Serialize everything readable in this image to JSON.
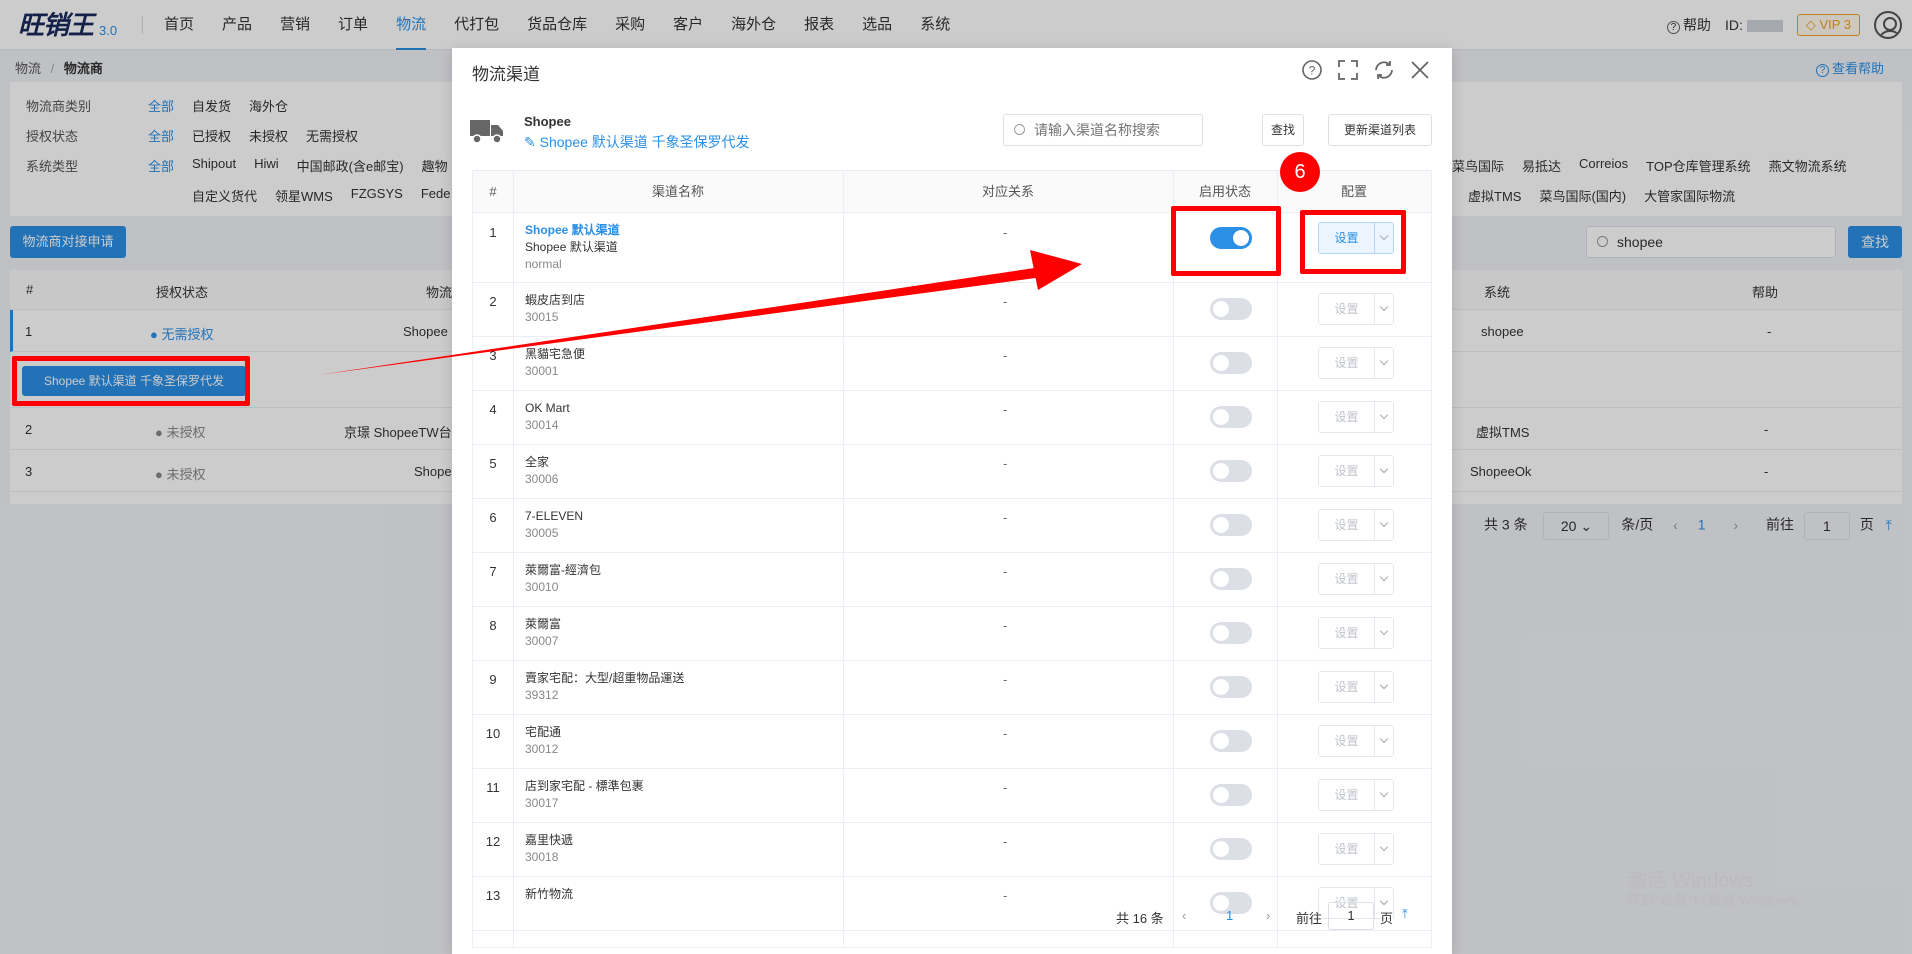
{
  "logo": {
    "text": "旺销王",
    "version": "3.0"
  },
  "nav": [
    "首页",
    "产品",
    "营销",
    "订单",
    "物流",
    "代打包",
    "货品仓库",
    "采购",
    "客户",
    "海外仓",
    "报表",
    "选品",
    "系统"
  ],
  "top_right": {
    "help": "帮助",
    "id_label": "ID:",
    "vip": "VIP 3"
  },
  "breadcrumb": {
    "parent": "物流",
    "current": "物流商"
  },
  "help_link": "查看帮助",
  "filters": {
    "carrier_type": {
      "label": "物流商类别",
      "options": [
        "全部",
        "自发货",
        "海外仓"
      ]
    },
    "auth_status": {
      "label": "授权状态",
      "options": [
        "全部",
        "已授权",
        "未授权",
        "无需授权"
      ]
    },
    "system_type": {
      "label": "系统类型",
      "options_left": [
        "全部",
        "Shipout",
        "Hiwi",
        "中国邮政(含e邮宝)",
        "趣物"
      ],
      "options_right": [
        "菜鸟国际",
        "易抵达",
        "Correios",
        "TOP仓库管理系统",
        "燕文物流系统"
      ],
      "row2_left": [
        "自定义货代",
        "领星WMS",
        "FZGSYS",
        "Fede"
      ],
      "row2_right": [
        "虚拟TMS",
        "菜鸟国际(国内)",
        "大管家国际物流"
      ]
    }
  },
  "apply_button": "物流商对接申请",
  "search": {
    "value": "shopee",
    "button": "查找"
  },
  "main_table": {
    "headers": [
      "#",
      "授权状态",
      "物流",
      "系统",
      "帮助"
    ],
    "rows": [
      {
        "num": "1",
        "status": "无需授权",
        "carrier": "Shopee",
        "system": "shopee",
        "help": "-"
      },
      {
        "num": "2",
        "status": "未授权",
        "carrier": "京璟 ShopeeTW台",
        "system": "虚拟TMS",
        "help": "-"
      },
      {
        "num": "3",
        "status": "未授权",
        "carrier": "Shope",
        "system": "ShopeeOk",
        "help": "-"
      }
    ],
    "expanded_channel": "Shopee 默认渠道 千象圣保罗代发"
  },
  "main_pager": {
    "total": "共 3 条",
    "page_size": "20",
    "per_page": "条/页",
    "page": "1",
    "goto": "前往",
    "goto_value": "1",
    "page_unit": "页"
  },
  "watermark": {
    "line1": "激活 Windows",
    "line2": "转到\"设置\"以激活 Windows。"
  },
  "dialog": {
    "title": "物流渠道",
    "carrier_name": "Shopee",
    "carrier_channel": "Shopee 默认渠道 千象圣保罗代发",
    "search_placeholder": "请输入渠道名称搜索",
    "find_button": "查找",
    "refresh_button": "更新渠道列表",
    "headers": [
      "#",
      "渠道名称",
      "对应关系",
      "启用状态",
      "配置"
    ],
    "config_label": "设置",
    "rows": [
      {
        "num": "1",
        "name": "Shopee 默认渠道",
        "sub": "Shopee 默认渠道",
        "code": "normal",
        "relation": "-",
        "enabled": true
      },
      {
        "num": "2",
        "name": "蝦皮店到店",
        "code": "30015",
        "relation": "-",
        "enabled": false
      },
      {
        "num": "3",
        "name": "黑貓宅急便",
        "code": "30001",
        "relation": "-",
        "enabled": false
      },
      {
        "num": "4",
        "name": "OK Mart",
        "code": "30014",
        "relation": "-",
        "enabled": false
      },
      {
        "num": "5",
        "name": "全家",
        "code": "30006",
        "relation": "-",
        "enabled": false
      },
      {
        "num": "6",
        "name": "7-ELEVEN",
        "code": "30005",
        "relation": "-",
        "enabled": false
      },
      {
        "num": "7",
        "name": "萊爾富-經濟包",
        "code": "30010",
        "relation": "-",
        "enabled": false
      },
      {
        "num": "8",
        "name": "萊爾富",
        "code": "30007",
        "relation": "-",
        "enabled": false
      },
      {
        "num": "9",
        "name": "賣家宅配：大型/超重物品運送",
        "code": "39312",
        "relation": "-",
        "enabled": false
      },
      {
        "num": "10",
        "name": "宅配通",
        "code": "30012",
        "relation": "-",
        "enabled": false
      },
      {
        "num": "11",
        "name": "店到家宅配 - 標準包裹",
        "code": "30017",
        "relation": "-",
        "enabled": false
      },
      {
        "num": "12",
        "name": "嘉里快遞",
        "code": "30018",
        "relation": "-",
        "enabled": false
      },
      {
        "num": "13",
        "name": "新竹物流",
        "code": "",
        "relation": "-",
        "enabled": false
      }
    ],
    "pager": {
      "total": "共 16 条",
      "page": "1",
      "goto": "前往",
      "goto_value": "1",
      "page_unit": "页"
    }
  },
  "annotation": {
    "step": "6"
  }
}
